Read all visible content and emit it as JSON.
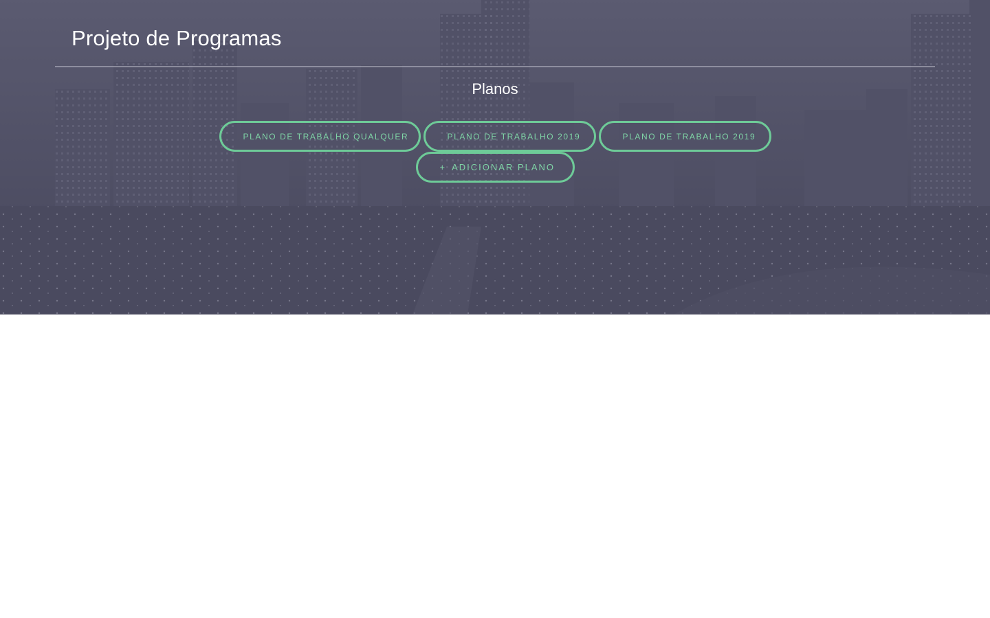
{
  "header": {
    "title": "Projeto de Programas"
  },
  "plans": {
    "heading": "Planos",
    "items": [
      {
        "label": "Plano de Trabalho Qualquer"
      },
      {
        "label": "Plano de Trabalho 2019"
      },
      {
        "label": "Plano de Trabalho 2019"
      }
    ],
    "add_icon": "+",
    "add_label": "Adicionar Plano"
  },
  "colors": {
    "accent": "#6ecb98",
    "hero_overlay": "#4e4e64",
    "page_background": "#ffffff"
  }
}
